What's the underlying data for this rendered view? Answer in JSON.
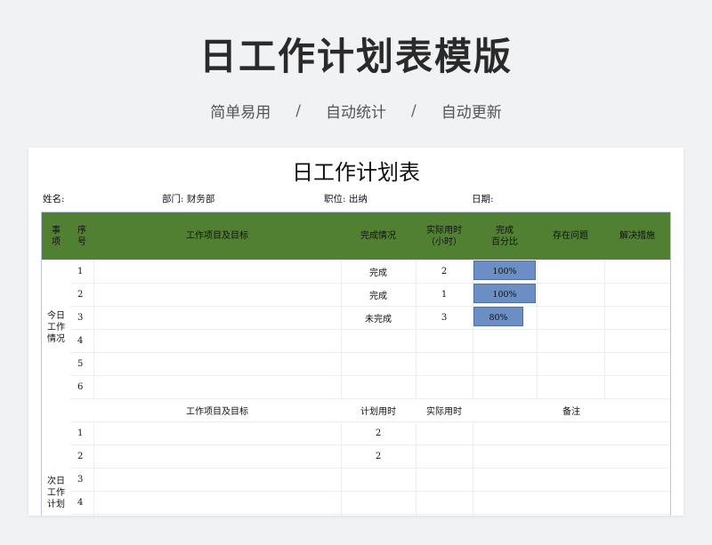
{
  "hero": {
    "title": "日工作计划表模版",
    "tags": [
      "简单易用",
      "自动统计",
      "自动更新"
    ],
    "separator": "/"
  },
  "doc": {
    "title": "日工作计划表",
    "name_label": "姓名:",
    "dept_label": "部门: 财务部",
    "position_label": "职位: 出纳",
    "date_label": "日期:"
  },
  "header": {
    "item": "事\n项",
    "seq": "序\n号",
    "task": "工作项目及目标",
    "status": "完成情况",
    "actual_time": "实际用时\n（小时）",
    "pct": "完成\n百分比",
    "issues": "存在问题",
    "solutions": "解决措施"
  },
  "today": {
    "label": "今日\n工作\n情况",
    "rows": [
      {
        "seq": "1",
        "status": "完成",
        "hours": "2",
        "pct_label": "100%",
        "pct": 1.0
      },
      {
        "seq": "2",
        "status": "完成",
        "hours": "1",
        "pct_label": "100%",
        "pct": 1.0
      },
      {
        "seq": "3",
        "status": "未完成",
        "hours": "3",
        "pct_label": "80%",
        "pct": 0.8
      },
      {
        "seq": "4",
        "status": "",
        "hours": "",
        "pct_label": "",
        "pct": 0
      },
      {
        "seq": "5",
        "status": "",
        "hours": "",
        "pct_label": "",
        "pct": 0
      },
      {
        "seq": "6",
        "status": "",
        "hours": "",
        "pct_label": "",
        "pct": 0
      }
    ]
  },
  "next_header": {
    "task": "工作项目及目标",
    "plan_time": "计划用时",
    "actual_time": "实际用时",
    "notes": "备注"
  },
  "next": {
    "label": "次日\n工作\n计划",
    "rows": [
      {
        "seq": "1",
        "plan": "2"
      },
      {
        "seq": "2",
        "plan": "2"
      },
      {
        "seq": "3",
        "plan": ""
      },
      {
        "seq": "4",
        "plan": ""
      }
    ]
  },
  "colors": {
    "header_green": "#518033",
    "bar_blue": "#6b8fc5"
  }
}
